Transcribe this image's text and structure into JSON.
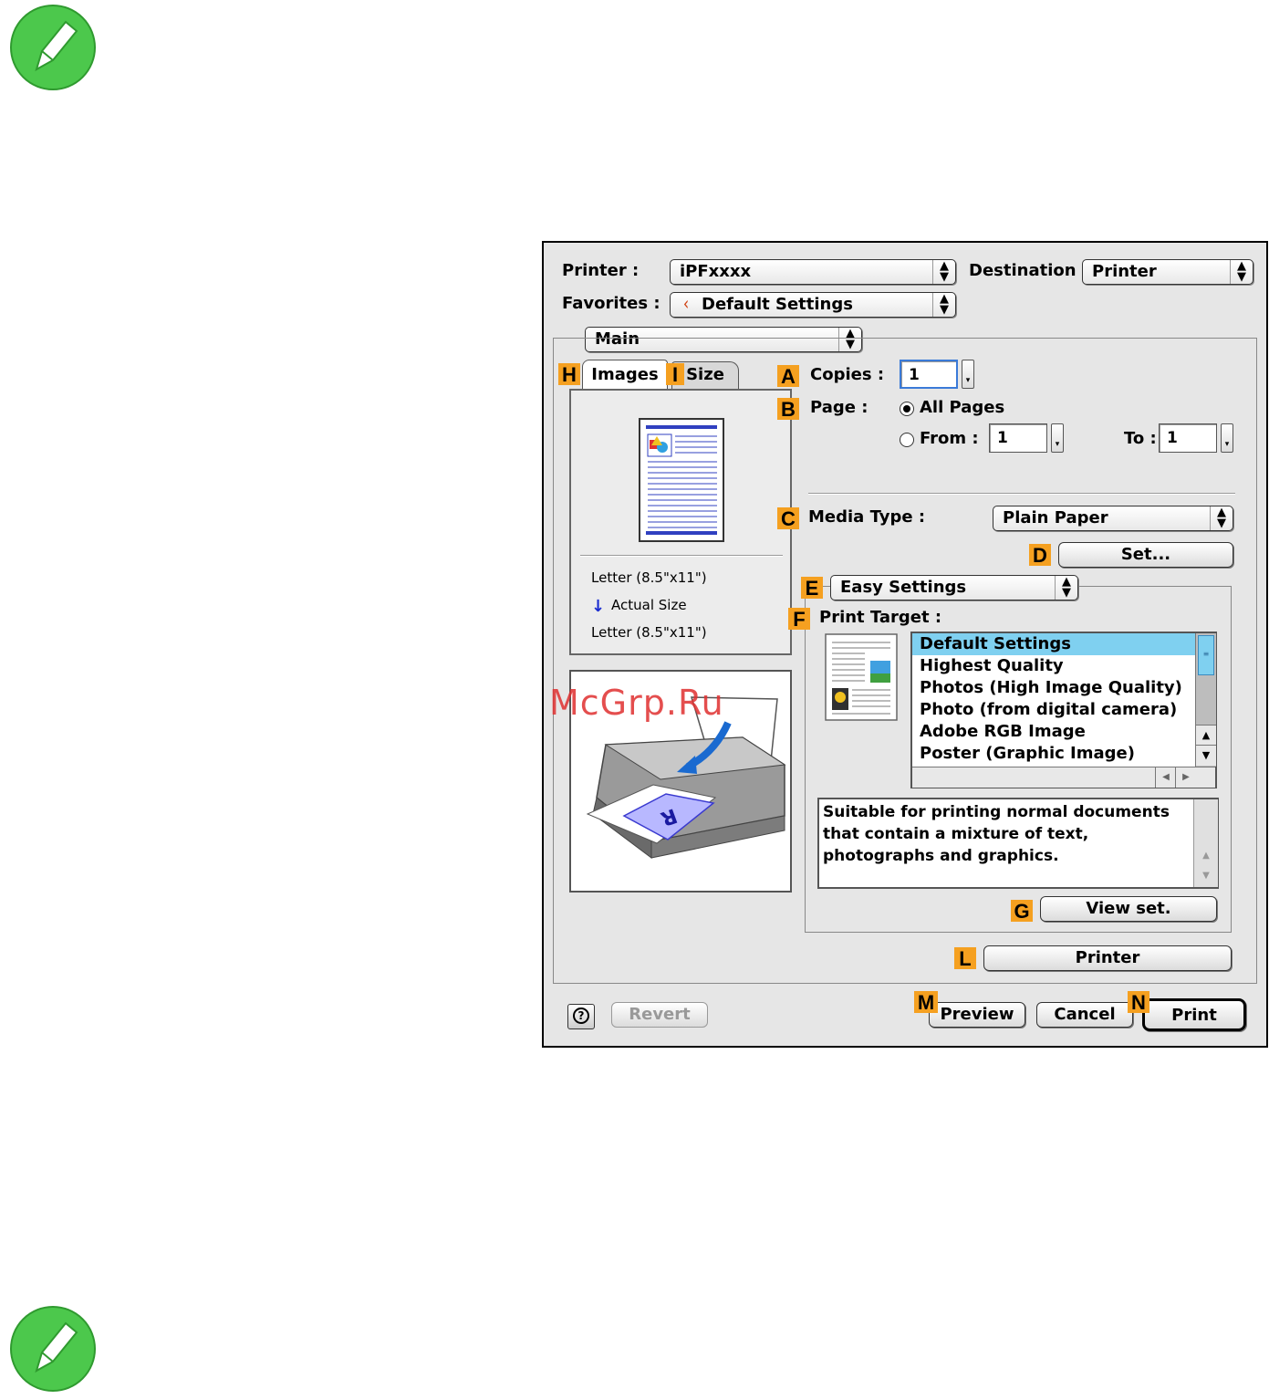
{
  "printer": {
    "label": "Printer :",
    "value": "iPFxxxx"
  },
  "destination": {
    "label": "Destination :",
    "value": "Printer"
  },
  "favorites": {
    "label": "Favorites :",
    "value": "Default Settings"
  },
  "main_menu": {
    "value": "Main"
  },
  "tabs": [
    {
      "label": "Images"
    },
    {
      "label": "Size"
    }
  ],
  "markers": {
    "A": "A",
    "B": "B",
    "C": "C",
    "D": "D",
    "E": "E",
    "F": "F",
    "G": "G",
    "H": "H",
    "I": "I",
    "L": "L",
    "M": "M",
    "N": "N"
  },
  "copies": {
    "label": "Copies :",
    "value": "1"
  },
  "page": {
    "label": "Page :",
    "all_pages": "All Pages",
    "from_label": "From :",
    "from_value": "1",
    "to_label": "To :",
    "to_value": "1"
  },
  "media_type": {
    "label": "Media Type :",
    "value": "Plain Paper"
  },
  "set_button": "Set...",
  "easy_settings": {
    "value": "Easy Settings"
  },
  "print_target": {
    "label": "Print Target :",
    "items": [
      "Default Settings",
      "Highest Quality",
      "Photos (High Image Quality)",
      "Photo (from digital camera)",
      "Adobe RGB Image",
      "Poster (Graphic Image)"
    ],
    "selected_index": 0
  },
  "description": "Suitable for printing normal documents that contain a mixture of text, photographs and graphics.",
  "view_set_button": "View set.",
  "printer_button": "Printer",
  "preview_panel": {
    "paper_in": "Letter (8.5\"x11\")",
    "scale": "Actual Size",
    "paper_out": "Letter (8.5\"x11\")"
  },
  "watermark": "McGrp.Ru",
  "footer": {
    "help": "?",
    "revert": "Revert",
    "preview": "Preview",
    "cancel": "Cancel",
    "print": "Print"
  },
  "colors": {
    "marker": "#f5a020",
    "selection": "#7fd0f0",
    "note_icon": "#4cc84c"
  }
}
